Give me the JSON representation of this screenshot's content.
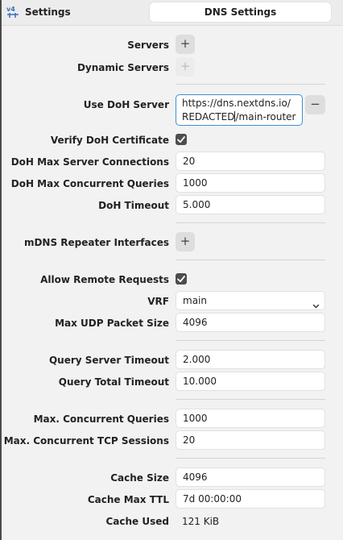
{
  "header": {
    "app_title": "Settings",
    "page_title": "DNS Settings"
  },
  "form": {
    "servers_label": "Servers",
    "dynamic_servers_label": "Dynamic Servers",
    "use_doh_label": "Use DoH Server",
    "use_doh_value_line1": "https://dns.nextdns.io/",
    "use_doh_value_line2a": "REDACTED",
    "use_doh_value_line2b": "/main-router",
    "verify_doh_label": "Verify DoH Certificate",
    "verify_doh_checked": true,
    "doh_max_conn_label": "DoH Max Server Connections",
    "doh_max_conn_value": "20",
    "doh_max_queries_label": "DoH Max Concurrent Queries",
    "doh_max_queries_value": "1000",
    "doh_timeout_label": "DoH Timeout",
    "doh_timeout_value": "5.000",
    "mdns_label": "mDNS Repeater Interfaces",
    "allow_remote_label": "Allow Remote Requests",
    "allow_remote_checked": true,
    "vrf_label": "VRF",
    "vrf_value": "main",
    "max_udp_label": "Max UDP Packet Size",
    "max_udp_value": "4096",
    "query_server_timeout_label": "Query Server Timeout",
    "query_server_timeout_value": "2.000",
    "query_total_timeout_label": "Query Total Timeout",
    "query_total_timeout_value": "10.000",
    "max_conc_queries_label": "Max. Concurrent Queries",
    "max_conc_queries_value": "1000",
    "max_conc_tcp_label": "Max. Concurrent TCP Sessions",
    "max_conc_tcp_value": "20",
    "cache_size_label": "Cache Size",
    "cache_size_value": "4096",
    "cache_max_ttl_label": "Cache Max TTL",
    "cache_max_ttl_value": "7d 00:00:00",
    "cache_used_label": "Cache Used",
    "cache_used_value": "121 KiB"
  },
  "icons": {
    "add": "+",
    "remove": "−"
  },
  "colors": {
    "accent": "#3d8fd6",
    "checkbox": "#4d4d4d",
    "panel": "#f2f2f2"
  }
}
